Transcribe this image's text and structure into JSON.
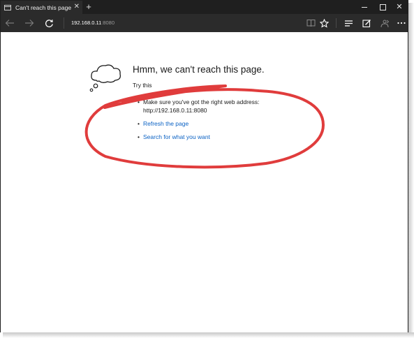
{
  "window": {
    "tab_title": "Can't reach this page",
    "new_tab_symbol": "+",
    "tab_close_symbol": "✕",
    "close_symbol": "✕"
  },
  "toolbar": {
    "address_host": "192.168.0.11",
    "address_port": ":8080",
    "icons": [
      "back-icon",
      "forward-icon",
      "refresh-icon",
      "reading-view-icon",
      "favorite-star-icon",
      "hub-icon",
      "web-note-icon",
      "share-icon",
      "more-icon"
    ]
  },
  "error_page": {
    "heading": "Hmm, we can't reach this page.",
    "try_this": "Try this",
    "suggestions": [
      "Make sure you've got the right web address: http://192.168.0.11:8080",
      "Refresh the page",
      "Search for what you want"
    ],
    "link_color": "#0b62c4"
  },
  "annotation": {
    "color": "#e03c3c",
    "shape": "hand-drawn-ellipse-around-suggestions"
  }
}
